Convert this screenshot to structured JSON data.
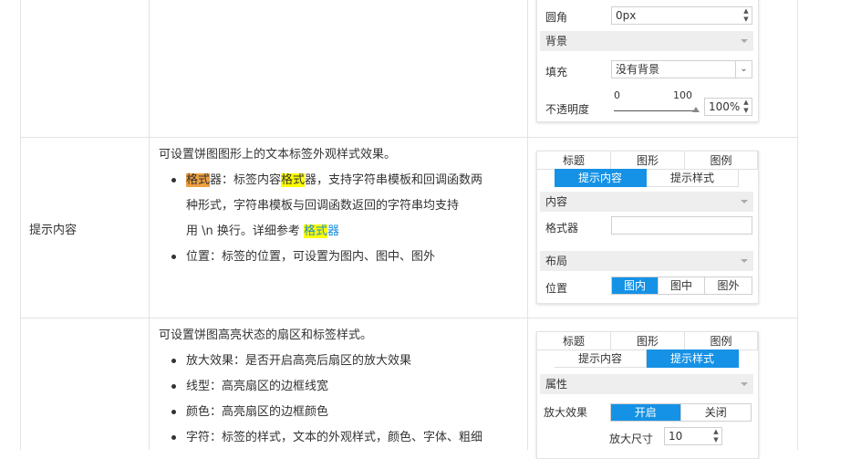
{
  "rows": [
    {
      "name": "",
      "panel": {
        "radius_label": "圆角",
        "radius_value": "0px",
        "section_bg": "背景",
        "fill_label": "填充",
        "fill_value": "没有背景",
        "opacity_label": "不透明度",
        "slider_min": "0",
        "slider_max": "100",
        "opacity_value": "100%"
      }
    },
    {
      "name": "提示内容",
      "intro": "可设置饼图图形上的文本标签外观样式效果。",
      "b1_part1": "格式",
      "b1_part2": "器：标签内容",
      "b1_part3": "格式",
      "b1_part4": "器，支持字符串模板和回调函数两",
      "b1_line2": "种形式，字符串模板与回调函数返回的字符串均支持",
      "b1_line3_pre": "用 \\n 换行。详细参考 ",
      "b1_link_hl": "格式",
      "b1_link_rest": "器",
      "b2": "位置：标签的位置，可设置为图内、图中、图外",
      "panel": {
        "tabs1": [
          "标题",
          "图形",
          "图例"
        ],
        "tabs2": [
          "提示内容",
          "提示样式"
        ],
        "section_content": "内容",
        "formatter_label": "格式器",
        "formatter_value": "",
        "section_layout": "布局",
        "position_label": "位置",
        "position_options": [
          "图内",
          "图中",
          "图外"
        ]
      }
    },
    {
      "name": "",
      "intro": "可设置饼图高亮状态的扇区和标签样式。",
      "b1": "放大效果：是否开启高亮后扇区的放大效果",
      "b2": "线型：高亮扇区的边框线宽",
      "b3": "颜色：高亮扇区的边框颜色",
      "b4": "字符：标签的样式，文本的外观样式，颜色、字体、粗细",
      "panel": {
        "tabs1": [
          "标题",
          "图形",
          "图例"
        ],
        "tabs2": [
          "提示内容",
          "提示样式"
        ],
        "section_attr": "属性",
        "zoom_label": "放大效果",
        "zoom_options": [
          "开启",
          "关闭"
        ],
        "zoom_size_label": "放大尺寸",
        "zoom_size_value": "10"
      }
    }
  ],
  "colors": {
    "accent": "#1592e6",
    "highlight_yellow": "#ffff00",
    "highlight_orange": "#f0a040",
    "link": "#1a8ad8"
  }
}
